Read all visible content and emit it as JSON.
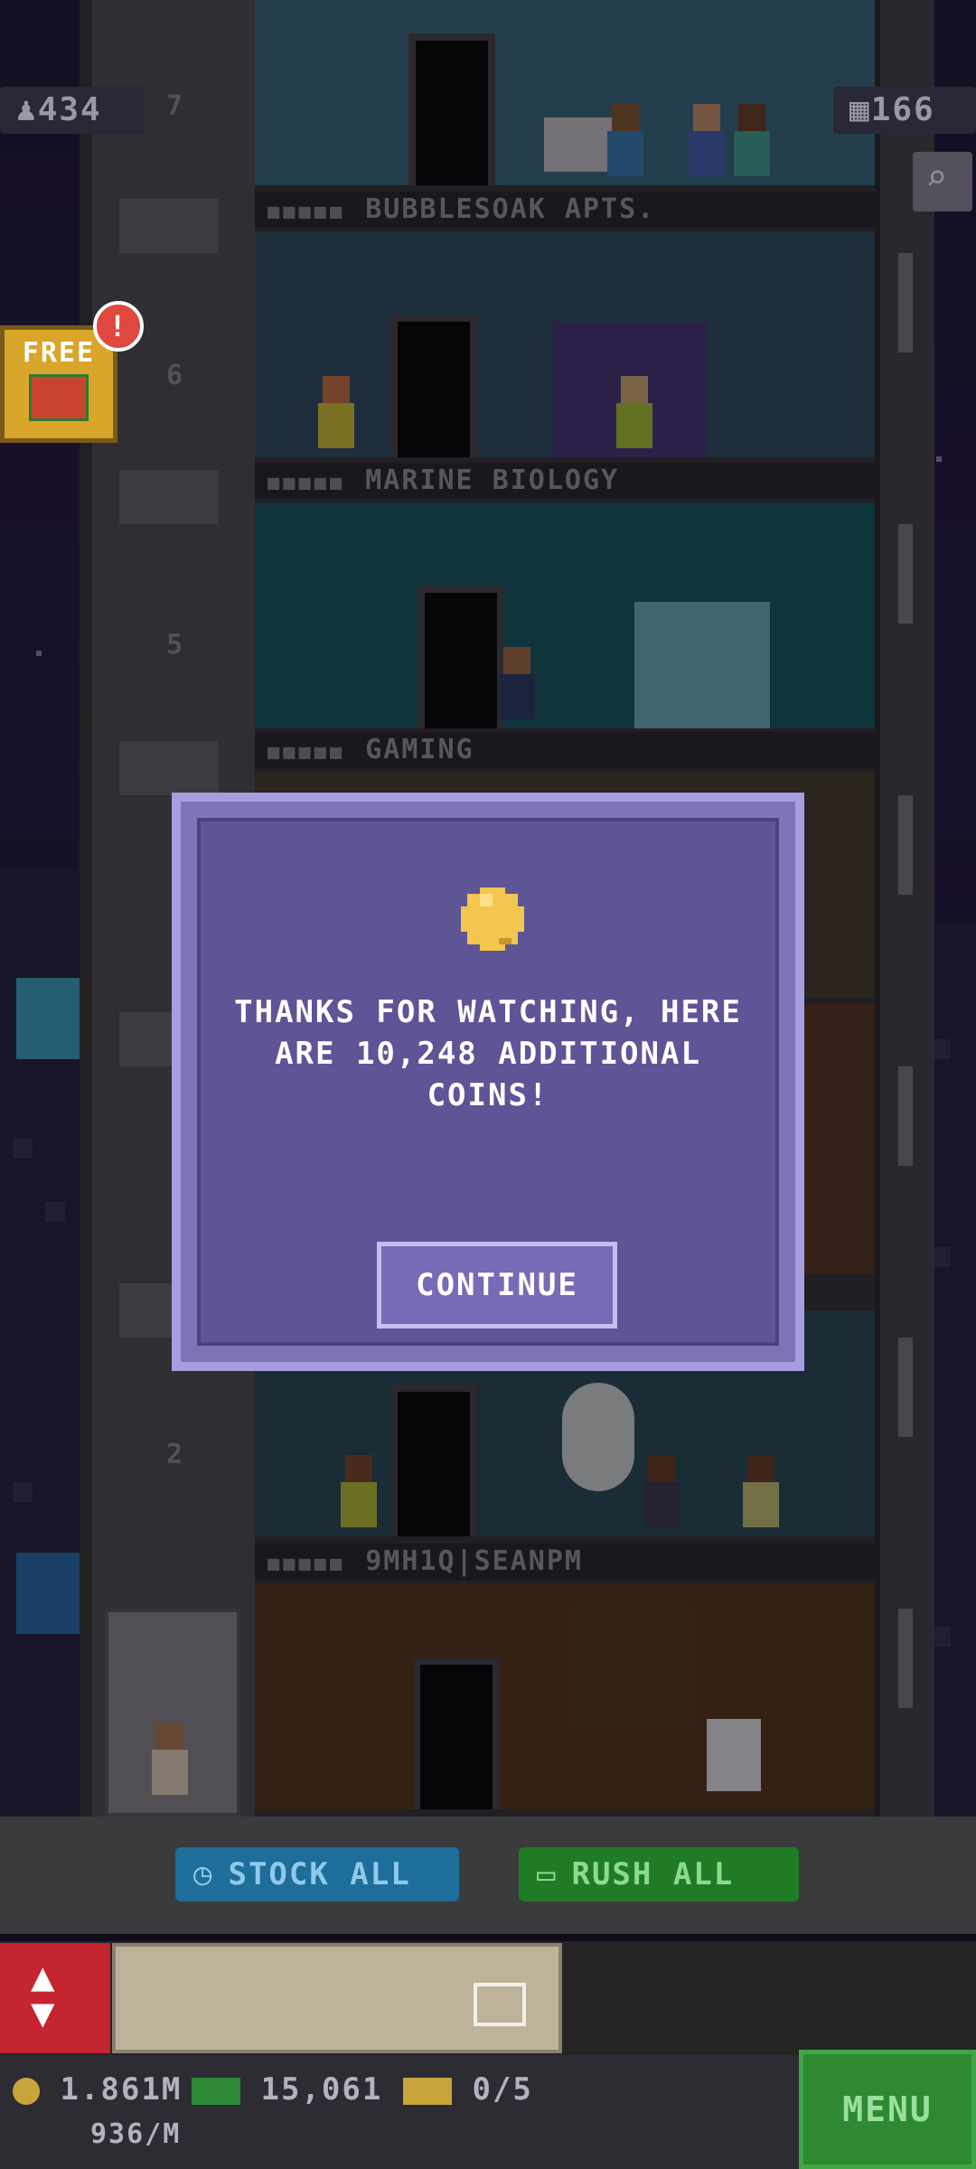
{
  "hud": {
    "population": "434",
    "bux": "166"
  },
  "gift": {
    "label": "FREE",
    "notification": "!"
  },
  "floors": [
    {
      "number": "7",
      "name": ""
    },
    {
      "number": "6",
      "name": "BUBBLESOAK APTS."
    },
    {
      "number": "5",
      "name": "MARINE BIOLOGY"
    },
    {
      "number": "",
      "name": "GAMING"
    },
    {
      "number": "2",
      "name": ""
    },
    {
      "number": "",
      "name": "9MH1Q|SEANPM"
    }
  ],
  "dialog": {
    "message": "THANKS FOR WATCHING, HERE ARE 10,248 ADDITIONAL COINS!",
    "button_label": "CONTINUE"
  },
  "actions": {
    "stock_all": "STOCK ALL",
    "rush_all": "RUSH ALL"
  },
  "status": {
    "coins": "1.861M",
    "coin_rate": "936/M",
    "bux": "15,061",
    "tickets": "0/5",
    "menu": "MENU"
  },
  "colors": {
    "dialog_bg": "#5d5596",
    "dialog_border": "#a69ee0",
    "stock_btn": "#1d6e9a",
    "rush_btn": "#1f7c25",
    "menu_btn": "#2d8a33"
  }
}
